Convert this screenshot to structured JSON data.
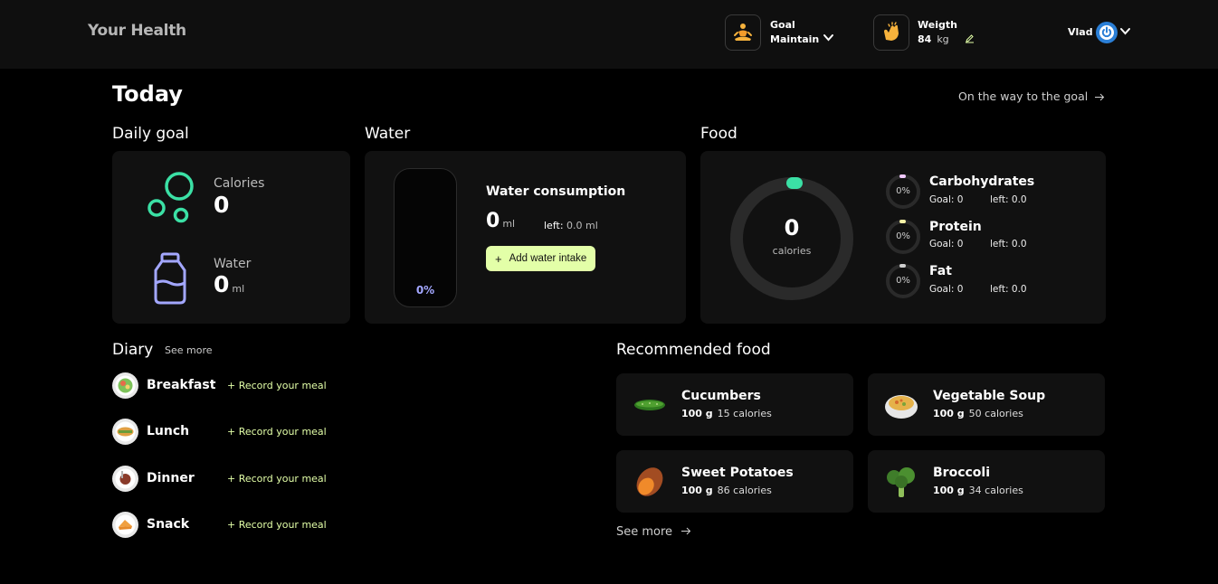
{
  "header": {
    "logo": "Your Health",
    "goal": {
      "label": "Goal",
      "value": "Maintain",
      "icon": "meditation-icon"
    },
    "weight": {
      "label": "Weigth",
      "value": "84",
      "unit": "kg",
      "icon": "clap-icon"
    },
    "user": {
      "name": "Vlad"
    }
  },
  "page": {
    "title": "Today",
    "goal_link": "On the way to the goal"
  },
  "daily_goal": {
    "title": "Daily goal",
    "calories_label": "Calories",
    "calories_value": "0",
    "water_label": "Water",
    "water_value": "0",
    "water_unit": "ml"
  },
  "water": {
    "title": "Water",
    "heading": "Water consumption",
    "value": "0",
    "unit": "ml",
    "left_label": "left:",
    "left_value": "0.0 ml",
    "percent": "0%",
    "add_button": "Add water intake"
  },
  "food": {
    "title": "Food",
    "calories_value": "0",
    "calories_label": "calories",
    "macros": [
      {
        "name": "Carbohydrates",
        "percent": "0%",
        "goal_label": "Goal:",
        "goal": "0",
        "left_label": "left:",
        "left": "0.0",
        "color": "#f1c9ff"
      },
      {
        "name": "Protein",
        "percent": "0%",
        "goal_label": "Goal:",
        "goal": "0",
        "left_label": "left:",
        "left": "0.0",
        "color": "#f7f2a6"
      },
      {
        "name": "Fat",
        "percent": "0%",
        "goal_label": "Goal:",
        "goal": "0",
        "left_label": "left:",
        "left": "0.0",
        "color": "#cfcfcf"
      }
    ]
  },
  "diary": {
    "title": "Diary",
    "see_more": "See more",
    "items": [
      {
        "name": "Breakfast",
        "action": "+ Record your meal"
      },
      {
        "name": "Lunch",
        "action": "+ Record your meal"
      },
      {
        "name": "Dinner",
        "action": "+ Record your meal"
      },
      {
        "name": "Snack",
        "action": "+ Record your meal"
      }
    ]
  },
  "recommended": {
    "title": "Recommended food",
    "see_more": "See more",
    "items": [
      {
        "name": "Cucumbers",
        "amount": "100 g",
        "calories": "15 calories"
      },
      {
        "name": "Vegetable Soup",
        "amount": "100 g",
        "calories": "50 calories"
      },
      {
        "name": "Sweet Potatoes",
        "amount": "100 g",
        "calories": "86 calories"
      },
      {
        "name": "Broccoli",
        "amount": "100 g",
        "calories": "34 calories"
      }
    ]
  },
  "colors": {
    "accent_green": "#3be0a5",
    "accent_lime": "#e3ffa8",
    "accent_violet": "#a3a7ff"
  }
}
